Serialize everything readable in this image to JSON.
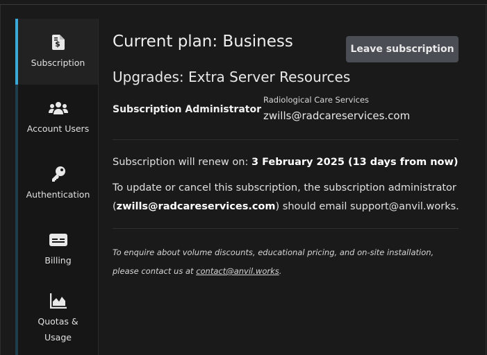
{
  "sidebar": {
    "items": [
      {
        "label": "Subscription",
        "icon": "dollar-document-icon",
        "active": true
      },
      {
        "label": "Account Users",
        "icon": "users-icon",
        "active": false
      },
      {
        "label": "Authentication",
        "icon": "key-icon",
        "active": false
      },
      {
        "label": "Billing",
        "icon": "credit-card-icon",
        "active": false
      },
      {
        "label": "Quotas &",
        "label2": "Usage",
        "icon": "area-chart-icon",
        "active": false
      }
    ]
  },
  "main": {
    "title": "Current plan: Business",
    "leave_button": "Leave subscription",
    "upgrades": "Upgrades: Extra Server Resources",
    "admin_label": "Subscription Administrator",
    "org_name": "Radiological Care Services",
    "admin_email": "zwills@radcareservices.com",
    "renew_prefix": "Subscription will renew on: ",
    "renew_date": "3 February 2025 (13 days from now)",
    "update_prefix": "To update or cancel this subscription, the subscription administrator (",
    "update_email": "zwills@radcareservices.com",
    "update_suffix": ") should email support@anvil.works.",
    "enquire_text": "To enquire about volume discounts, educational pricing, and on-site installation, please contact us at ",
    "enquire_link": "contact@anvil.works",
    "enquire_end": "."
  },
  "colors": {
    "background": "#1a1a1a",
    "active_accent": "#3aa8d8",
    "button_bg": "#4a4d53"
  }
}
